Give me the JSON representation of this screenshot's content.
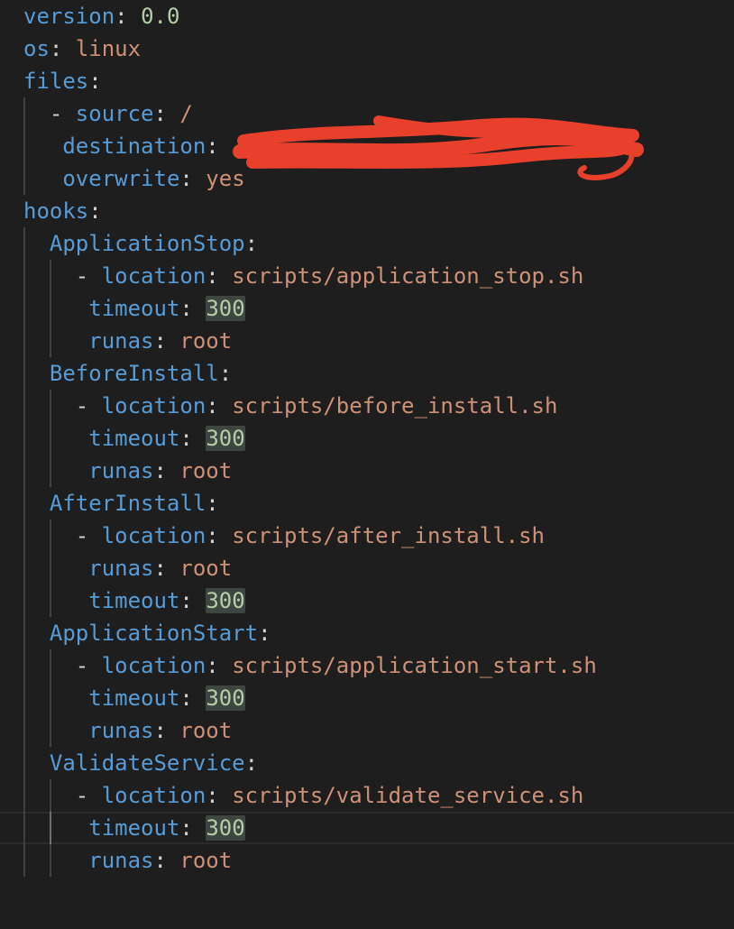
{
  "doc": {
    "lines": [
      {
        "indent": 0,
        "dash": false,
        "key": "version",
        "value": "0.0",
        "vtype": "num"
      },
      {
        "indent": 0,
        "dash": false,
        "key": "os",
        "value": "linux",
        "vtype": "str"
      },
      {
        "indent": 0,
        "dash": false,
        "key": "files",
        "value": "",
        "vtype": "none"
      },
      {
        "indent": 1,
        "dash": true,
        "key": "source",
        "value": "/",
        "vtype": "str"
      },
      {
        "indent": 1.5,
        "dash": false,
        "key": "destination",
        "value": "",
        "vtype": "none"
      },
      {
        "indent": 1.5,
        "dash": false,
        "key": "overwrite",
        "value": "yes",
        "vtype": "str"
      },
      {
        "indent": 0,
        "dash": false,
        "key": "hooks",
        "value": "",
        "vtype": "none"
      },
      {
        "indent": 1,
        "dash": false,
        "key": "ApplicationStop",
        "value": "",
        "vtype": "none"
      },
      {
        "indent": 2,
        "dash": true,
        "key": "location",
        "value": "scripts/application_stop.sh",
        "vtype": "str"
      },
      {
        "indent": 2.5,
        "dash": false,
        "key": "timeout",
        "value": "300",
        "vtype": "numhl"
      },
      {
        "indent": 2.5,
        "dash": false,
        "key": "runas",
        "value": "root",
        "vtype": "str"
      },
      {
        "indent": 1,
        "dash": false,
        "key": "BeforeInstall",
        "value": "",
        "vtype": "none"
      },
      {
        "indent": 2,
        "dash": true,
        "key": "location",
        "value": "scripts/before_install.sh",
        "vtype": "str"
      },
      {
        "indent": 2.5,
        "dash": false,
        "key": "timeout",
        "value": "300",
        "vtype": "numhl"
      },
      {
        "indent": 2.5,
        "dash": false,
        "key": "runas",
        "value": "root",
        "vtype": "str"
      },
      {
        "indent": 1,
        "dash": false,
        "key": "AfterInstall",
        "value": "",
        "vtype": "none"
      },
      {
        "indent": 2,
        "dash": true,
        "key": "location",
        "value": "scripts/after_install.sh",
        "vtype": "str"
      },
      {
        "indent": 2.5,
        "dash": false,
        "key": "runas",
        "value": "root",
        "vtype": "str"
      },
      {
        "indent": 2.5,
        "dash": false,
        "key": "timeout",
        "value": "300",
        "vtype": "numhl"
      },
      {
        "indent": 1,
        "dash": false,
        "key": "ApplicationStart",
        "value": "",
        "vtype": "none"
      },
      {
        "indent": 2,
        "dash": true,
        "key": "location",
        "value": "scripts/application_start.sh",
        "vtype": "str"
      },
      {
        "indent": 2.5,
        "dash": false,
        "key": "timeout",
        "value": "300",
        "vtype": "numhl"
      },
      {
        "indent": 2.5,
        "dash": false,
        "key": "runas",
        "value": "root",
        "vtype": "str"
      },
      {
        "indent": 1,
        "dash": false,
        "key": "ValidateService",
        "value": "",
        "vtype": "none"
      },
      {
        "indent": 2,
        "dash": true,
        "key": "location",
        "value": "scripts/validate_service.sh",
        "vtype": "str"
      },
      {
        "indent": 2.5,
        "dash": false,
        "key": "timeout",
        "value": "300",
        "vtype": "numhl",
        "current": true
      },
      {
        "indent": 2.5,
        "dash": false,
        "key": "runas",
        "value": "root",
        "vtype": "str"
      }
    ]
  },
  "redaction": {
    "color": "#e8402a"
  },
  "colors": {
    "background": "#1e1e1e",
    "key": "#569cd6",
    "string": "#ce9178",
    "number": "#b5cea8",
    "punctuation": "#d4d4d4"
  }
}
